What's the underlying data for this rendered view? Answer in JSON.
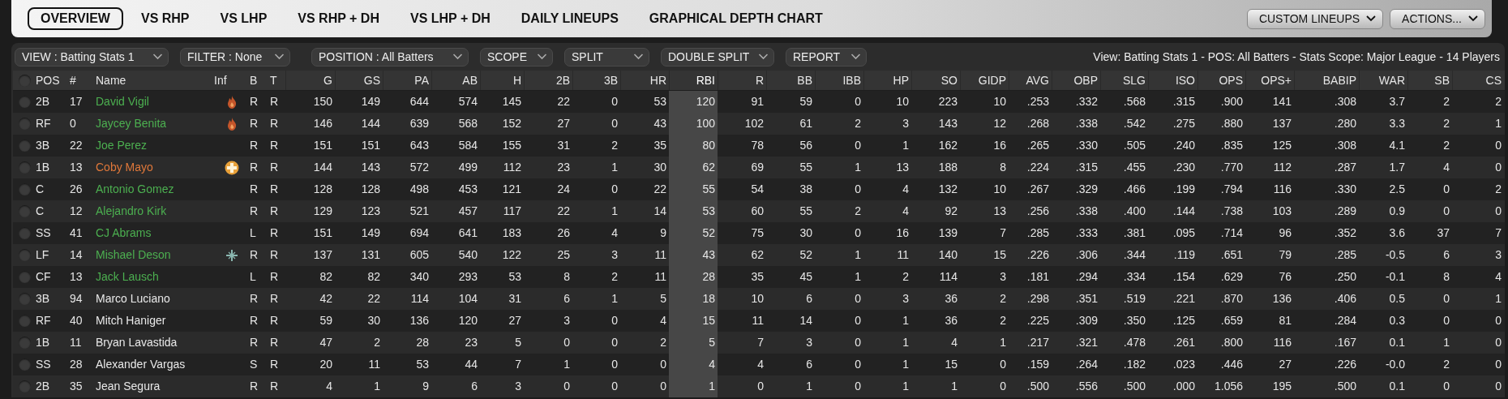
{
  "tabs": [
    {
      "label": "OVERVIEW",
      "selected": true
    },
    {
      "label": "VS RHP",
      "selected": false
    },
    {
      "label": "VS LHP",
      "selected": false
    },
    {
      "label": "VS RHP + DH",
      "selected": false
    },
    {
      "label": "VS LHP + DH",
      "selected": false
    },
    {
      "label": "DAILY LINEUPS",
      "selected": false
    },
    {
      "label": "GRAPHICAL DEPTH CHART",
      "selected": false
    }
  ],
  "header_buttons": [
    "CUSTOM LINEUPS",
    "ACTIONS..."
  ],
  "filters": [
    "VIEW : Batting Stats 1",
    "FILTER : None",
    "POSITION : All Batters",
    "SCOPE",
    "SPLIT",
    "DOUBLE SPLIT",
    "REPORT"
  ],
  "summary": "View: Batting Stats 1 - POS: All Batters - Stats Scope: Major League - 14 Players",
  "table": {
    "select_all": {
      "selected": false
    },
    "columns": [
      {
        "label": "POS",
        "sorted": false
      },
      {
        "label": "#",
        "sorted": false
      },
      {
        "label": "Name",
        "sorted": false
      },
      {
        "label": "Inf",
        "sorted": false
      },
      {
        "label": "B",
        "sorted": false
      },
      {
        "label": "T",
        "sorted": false
      },
      {
        "label": "G",
        "sorted": false
      },
      {
        "label": "GS",
        "sorted": false
      },
      {
        "label": "PA",
        "sorted": false
      },
      {
        "label": "AB",
        "sorted": false
      },
      {
        "label": "H",
        "sorted": false
      },
      {
        "label": "2B",
        "sorted": false
      },
      {
        "label": "3B",
        "sorted": false
      },
      {
        "label": "HR",
        "sorted": false
      },
      {
        "label": "RBI",
        "sorted": true
      },
      {
        "label": "R",
        "sorted": false
      },
      {
        "label": "BB",
        "sorted": false
      },
      {
        "label": "IBB",
        "sorted": false
      },
      {
        "label": "HP",
        "sorted": false
      },
      {
        "label": "SO",
        "sorted": false
      },
      {
        "label": "GIDP",
        "sorted": false
      },
      {
        "label": "AVG",
        "sorted": false
      },
      {
        "label": "OBP",
        "sorted": false
      },
      {
        "label": "SLG",
        "sorted": false
      },
      {
        "label": "ISO",
        "sorted": false
      },
      {
        "label": "OPS",
        "sorted": false
      },
      {
        "label": "OPS+",
        "sorted": false
      },
      {
        "label": "BABIP",
        "sorted": false
      },
      {
        "label": "WAR",
        "sorted": false
      },
      {
        "label": "SB",
        "sorted": false
      },
      {
        "label": "CS",
        "sorted": false
      }
    ],
    "rows": [
      {
        "selected": false,
        "pos": "2B",
        "number": "17",
        "name": "David Vigil",
        "color": "#4caf50",
        "badge": {
          "kind": "hot"
        },
        "bats": "R",
        "throws": "R",
        "stats": [
          "150",
          "149",
          "644",
          "574",
          "145",
          "22",
          "0",
          "53",
          "120",
          "91",
          "59",
          "0",
          "10",
          "223",
          "10",
          ".253",
          ".332",
          ".568",
          ".315",
          ".900",
          "141",
          ".308",
          "3.7",
          "2",
          "2"
        ]
      },
      {
        "selected": false,
        "pos": "RF",
        "number": "0",
        "name": "Jaycey Benita",
        "color": "#4caf50",
        "badge": {
          "kind": "hot"
        },
        "bats": "R",
        "throws": "R",
        "stats": [
          "146",
          "144",
          "639",
          "568",
          "152",
          "27",
          "0",
          "43",
          "100",
          "102",
          "61",
          "2",
          "3",
          "143",
          "12",
          ".268",
          ".338",
          ".542",
          ".275",
          ".880",
          "137",
          ".280",
          "3.3",
          "2",
          "1"
        ]
      },
      {
        "selected": false,
        "pos": "3B",
        "number": "22",
        "name": "Joe Perez",
        "color": "#4caf50",
        "bats": "R",
        "throws": "R",
        "stats": [
          "151",
          "151",
          "643",
          "584",
          "155",
          "31",
          "2",
          "35",
          "80",
          "78",
          "56",
          "0",
          "1",
          "162",
          "16",
          ".265",
          ".330",
          ".505",
          ".240",
          ".835",
          "125",
          ".308",
          "4.1",
          "2",
          "0"
        ]
      },
      {
        "selected": false,
        "pos": "1B",
        "number": "13",
        "name": "Coby Mayo",
        "color": "#e0783a",
        "badge": {
          "kind": "injured"
        },
        "bats": "R",
        "throws": "R",
        "stats": [
          "144",
          "143",
          "572",
          "499",
          "112",
          "23",
          "1",
          "30",
          "62",
          "69",
          "55",
          "1",
          "13",
          "188",
          "8",
          ".224",
          ".315",
          ".455",
          ".230",
          ".770",
          "112",
          ".287",
          "1.7",
          "4",
          "0"
        ]
      },
      {
        "selected": false,
        "pos": "C",
        "number": "26",
        "name": "Antonio Gomez",
        "color": "#4caf50",
        "bats": "R",
        "throws": "R",
        "stats": [
          "128",
          "128",
          "498",
          "453",
          "121",
          "24",
          "0",
          "22",
          "55",
          "54",
          "38",
          "0",
          "4",
          "132",
          "10",
          ".267",
          ".329",
          ".466",
          ".199",
          ".794",
          "116",
          ".330",
          "2.5",
          "0",
          "2"
        ]
      },
      {
        "selected": false,
        "pos": "C",
        "number": "12",
        "name": "Alejandro Kirk",
        "color": "#4caf50",
        "bats": "R",
        "throws": "R",
        "stats": [
          "129",
          "123",
          "521",
          "457",
          "117",
          "22",
          "1",
          "14",
          "53",
          "60",
          "55",
          "2",
          "4",
          "92",
          "13",
          ".256",
          ".338",
          ".400",
          ".144",
          ".738",
          "103",
          ".289",
          "0.9",
          "0",
          "0"
        ]
      },
      {
        "selected": false,
        "pos": "SS",
        "number": "41",
        "name": "CJ Abrams",
        "color": "#4caf50",
        "bats": "L",
        "throws": "R",
        "stats": [
          "151",
          "149",
          "694",
          "641",
          "183",
          "26",
          "4",
          "9",
          "52",
          "75",
          "30",
          "0",
          "16",
          "139",
          "7",
          ".285",
          ".333",
          ".381",
          ".095",
          ".714",
          "96",
          ".352",
          "3.6",
          "37",
          "7"
        ]
      },
      {
        "selected": false,
        "pos": "LF",
        "number": "14",
        "name": "Mishael Deson",
        "color": "#4caf50",
        "badge": {
          "kind": "cold"
        },
        "bats": "R",
        "throws": "R",
        "stats": [
          "137",
          "131",
          "605",
          "540",
          "122",
          "25",
          "3",
          "11",
          "43",
          "62",
          "52",
          "1",
          "11",
          "140",
          "15",
          ".226",
          ".306",
          ".344",
          ".119",
          ".651",
          "79",
          ".285",
          "-0.5",
          "6",
          "3"
        ]
      },
      {
        "selected": false,
        "pos": "CF",
        "number": "13",
        "name": "Jack Lausch",
        "color": "#4caf50",
        "bats": "L",
        "throws": "R",
        "stats": [
          "82",
          "82",
          "340",
          "293",
          "53",
          "8",
          "2",
          "11",
          "28",
          "35",
          "45",
          "1",
          "2",
          "114",
          "3",
          ".181",
          ".294",
          ".334",
          ".154",
          ".629",
          "76",
          ".250",
          "-0.1",
          "8",
          "4"
        ]
      },
      {
        "selected": false,
        "pos": "3B",
        "number": "94",
        "name": "Marco Luciano",
        "color": "#e8e8e8",
        "bats": "R",
        "throws": "R",
        "stats": [
          "42",
          "22",
          "114",
          "104",
          "31",
          "6",
          "1",
          "5",
          "18",
          "10",
          "6",
          "0",
          "3",
          "36",
          "2",
          ".298",
          ".351",
          ".519",
          ".221",
          ".870",
          "136",
          ".406",
          "0.5",
          "0",
          "1"
        ]
      },
      {
        "selected": false,
        "pos": "RF",
        "number": "40",
        "name": "Mitch Haniger",
        "color": "#e8e8e8",
        "bats": "R",
        "throws": "R",
        "stats": [
          "59",
          "30",
          "136",
          "120",
          "27",
          "3",
          "0",
          "4",
          "15",
          "11",
          "14",
          "0",
          "1",
          "36",
          "2",
          ".225",
          ".309",
          ".350",
          ".125",
          ".659",
          "81",
          ".284",
          "0.3",
          "0",
          "0"
        ]
      },
      {
        "selected": false,
        "pos": "1B",
        "number": "11",
        "name": "Bryan Lavastida",
        "color": "#e8e8e8",
        "bats": "R",
        "throws": "R",
        "stats": [
          "47",
          "2",
          "28",
          "23",
          "5",
          "0",
          "0",
          "2",
          "5",
          "7",
          "3",
          "0",
          "1",
          "4",
          "1",
          ".217",
          ".321",
          ".478",
          ".261",
          ".800",
          "116",
          ".167",
          "0.1",
          "1",
          "0"
        ]
      },
      {
        "selected": false,
        "pos": "SS",
        "number": "28",
        "name": "Alexander Vargas",
        "color": "#e8e8e8",
        "bats": "S",
        "throws": "R",
        "stats": [
          "20",
          "11",
          "53",
          "44",
          "7",
          "1",
          "0",
          "0",
          "4",
          "4",
          "6",
          "0",
          "1",
          "15",
          "0",
          ".159",
          ".264",
          ".182",
          ".023",
          ".446",
          "27",
          ".226",
          "-0.0",
          "2",
          "0"
        ]
      },
      {
        "selected": false,
        "pos": "2B",
        "number": "35",
        "name": "Jean Segura",
        "color": "#e8e8e8",
        "bats": "R",
        "throws": "R",
        "stats": [
          "4",
          "1",
          "9",
          "6",
          "3",
          "0",
          "0",
          "0",
          "1",
          "0",
          "1",
          "0",
          "1",
          "1",
          "0",
          ".500",
          ".556",
          ".500",
          ".000",
          "1.056",
          "195",
          ".500",
          "0.1",
          "0",
          "0"
        ]
      }
    ]
  }
}
